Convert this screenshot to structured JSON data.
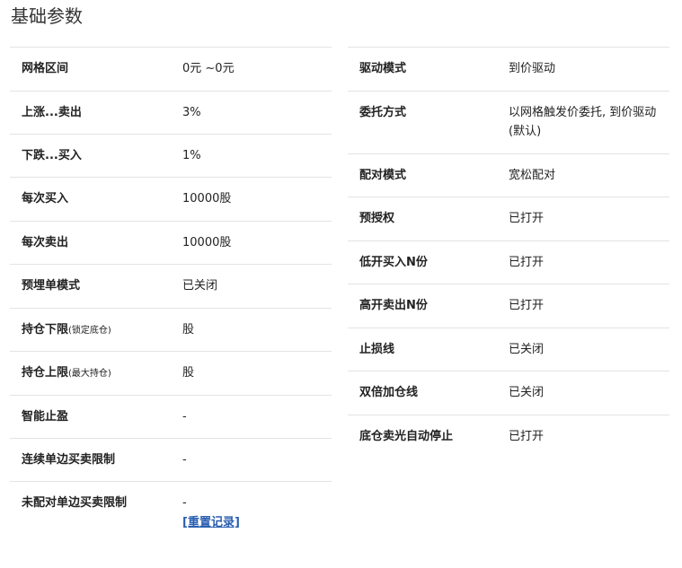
{
  "page": {
    "title": "基础参数"
  },
  "left_params": [
    {
      "key": "网格区间",
      "note": "",
      "value": "0元 ~0元"
    },
    {
      "key": "上涨...卖出",
      "note": "",
      "value": "3%"
    },
    {
      "key": "下跌...买入",
      "note": "",
      "value": "1%"
    },
    {
      "key": "每次买入",
      "note": "",
      "value": "10000股"
    },
    {
      "key": "每次卖出",
      "note": "",
      "value": "10000股"
    },
    {
      "key": "预埋单模式",
      "note": "",
      "value": "已关闭"
    },
    {
      "key": "持仓下限",
      "note": "(锁定底仓)",
      "value": "股"
    },
    {
      "key": "持仓上限",
      "note": "(最大持仓)",
      "value": "股"
    },
    {
      "key": "智能止盈",
      "note": "",
      "value": "-"
    },
    {
      "key": "连续单边买卖限制",
      "note": "",
      "value": "-"
    },
    {
      "key": "未配对单边买卖限制",
      "note": "",
      "value": "-",
      "link": "[重置记录]"
    }
  ],
  "right_params": [
    {
      "key": "驱动模式",
      "value": "到价驱动"
    },
    {
      "key": "委托方式",
      "value": "以网格触发价委托, 到价驱动(默认)"
    },
    {
      "key": "配对模式",
      "value": "宽松配对"
    },
    {
      "key": "预授权",
      "value": "已打开"
    },
    {
      "key": "低开买入N份",
      "value": "已打开"
    },
    {
      "key": "高开卖出N份",
      "value": "已打开"
    },
    {
      "key": "止损线",
      "value": "已关闭"
    },
    {
      "key": "双倍加仓线",
      "value": "已关闭"
    },
    {
      "key": "底仓卖光自动停止",
      "value": "已打开"
    }
  ]
}
